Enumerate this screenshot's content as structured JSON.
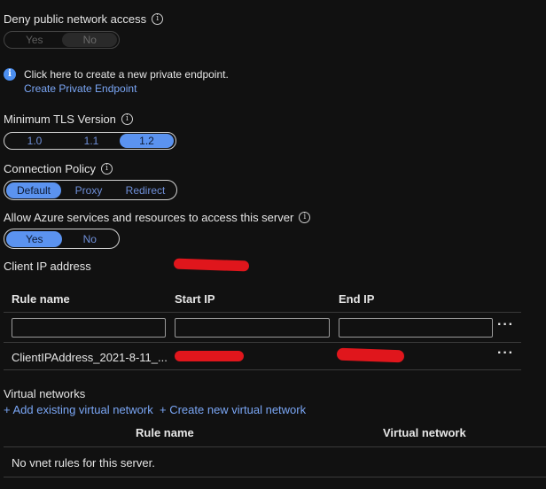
{
  "deny_public": {
    "label": "Deny public network access",
    "options": [
      "Yes",
      "No"
    ],
    "selected": "No"
  },
  "private_endpoint": {
    "message": "Click here to create a new private endpoint.",
    "link": "Create Private Endpoint"
  },
  "tls": {
    "label": "Minimum TLS Version",
    "options": [
      "1.0",
      "1.1",
      "1.2"
    ],
    "selected": "1.2"
  },
  "connection_policy": {
    "label": "Connection Policy",
    "options": [
      "Default",
      "Proxy",
      "Redirect"
    ],
    "selected": "Default"
  },
  "allow_azure": {
    "label": "Allow Azure services and resources to access this server",
    "options": [
      "Yes",
      "No"
    ],
    "selected": "Yes"
  },
  "client_ip": {
    "label": "Client IP address"
  },
  "firewall_table": {
    "headers": [
      "Rule name",
      "Start IP",
      "End IP"
    ],
    "rows": [
      {
        "rule_name": "ClientIPAddress_2021-8-11_..."
      }
    ]
  },
  "virtual_networks": {
    "title": "Virtual networks",
    "add_existing": "+ Add existing virtual network",
    "create_new": "+ Create new virtual network",
    "headers": [
      "Rule name",
      "Virtual network"
    ],
    "empty_message": "No vnet rules for this server."
  },
  "icons": {
    "info": "info-icon",
    "more": "more-icon"
  },
  "colors": {
    "accent": "#5b93f0",
    "link": "#7aa6f5",
    "background": "#111111",
    "redaction": "#e0161c"
  }
}
